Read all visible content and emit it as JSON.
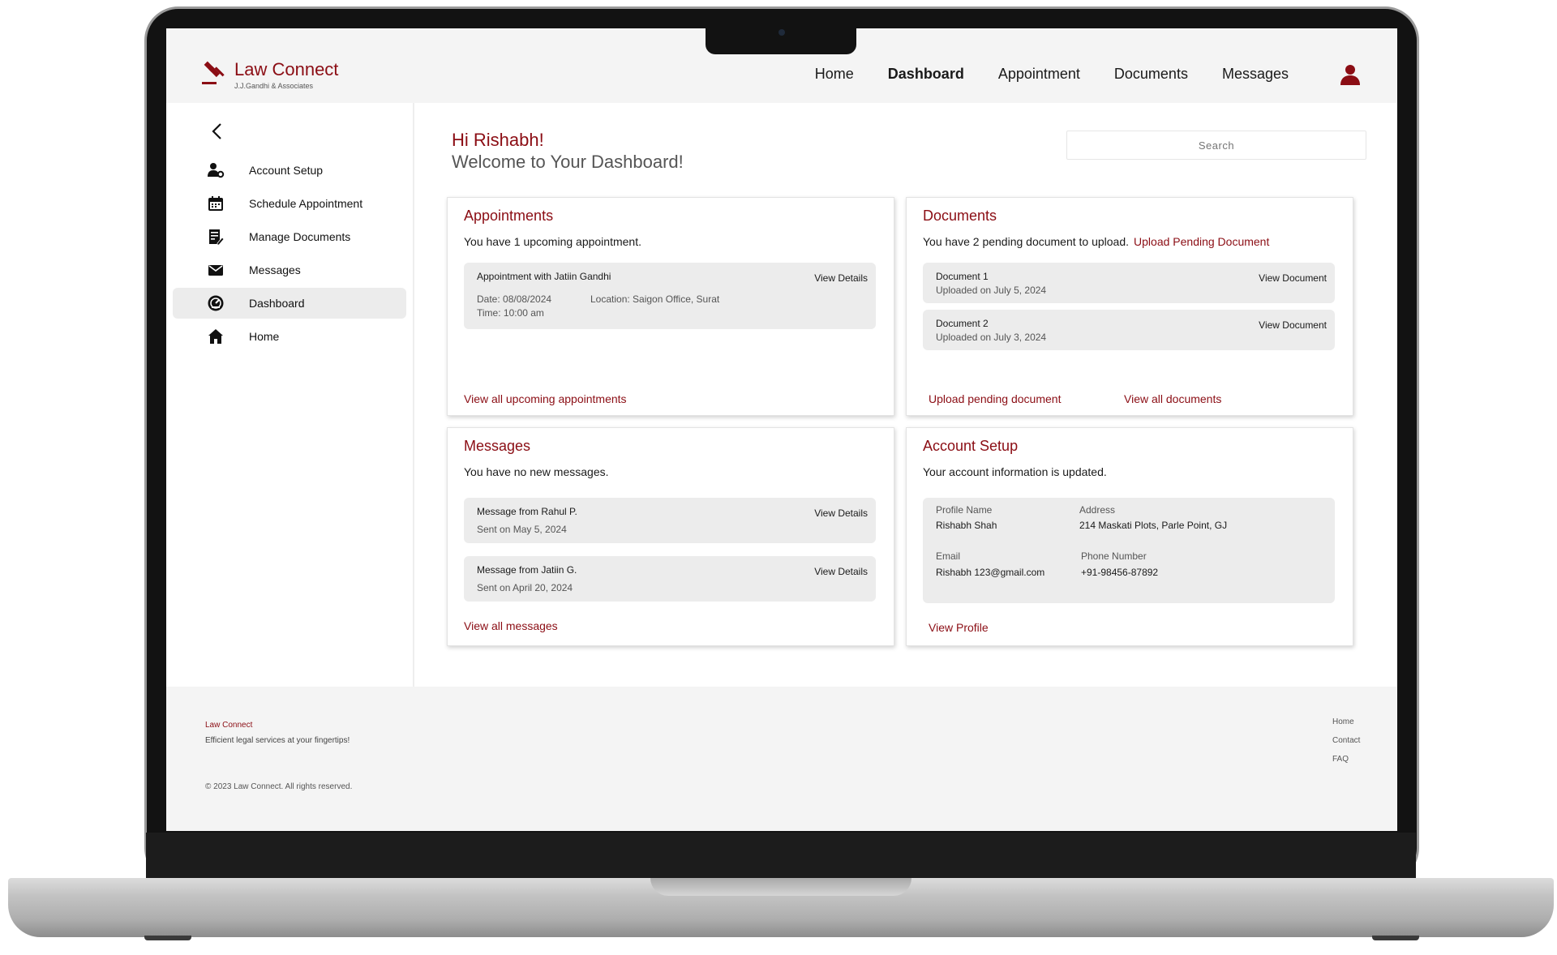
{
  "brand": {
    "name": "Law Connect",
    "subtitle": "J.J.Gandhi & Associates"
  },
  "nav": {
    "items": [
      "Home",
      "Dashboard",
      "Appointment",
      "Documents",
      "Messages"
    ],
    "active": "Dashboard"
  },
  "sidebar": {
    "items": [
      {
        "label": "Account Setup",
        "icon": "user-gear-icon"
      },
      {
        "label": "Schedule Appointment",
        "icon": "calendar-icon"
      },
      {
        "label": "Manage Documents",
        "icon": "document-edit-icon"
      },
      {
        "label": "Messages",
        "icon": "envelope-icon"
      },
      {
        "label": "Dashboard",
        "icon": "dashboard-gauge-icon"
      },
      {
        "label": "Home",
        "icon": "home-icon"
      }
    ],
    "active": "Dashboard"
  },
  "greeting": {
    "name_line": "Hi Rishabh!",
    "welcome_line": "Welcome to Your Dashboard!"
  },
  "search": {
    "placeholder": "Search"
  },
  "appointments": {
    "title": "Appointments",
    "summary": "You have 1 upcoming appointment.",
    "items": [
      {
        "title": "Appointment with Jatiin Gandhi",
        "date": "Date: 08/08/2024",
        "location": "Location: Saigon Office, Surat",
        "time": "Time: 10:00 am",
        "action": "View Details"
      }
    ],
    "footer_link": "View all upcoming appointments"
  },
  "documents": {
    "title": "Documents",
    "summary": "You have 2 pending document to upload.",
    "summary_link": "Upload Pending Document",
    "items": [
      {
        "title": "Document 1",
        "meta": "Uploaded on July 5, 2024",
        "action": "View Document"
      },
      {
        "title": "Document 2",
        "meta": "Uploaded on July 3, 2024",
        "action": "View Document"
      }
    ],
    "footer_links": [
      "Upload pending document",
      "View all documents"
    ]
  },
  "messages": {
    "title": "Messages",
    "summary": "You have no new messages.",
    "items": [
      {
        "title": "Message from Rahul P.",
        "meta": "Sent on May 5, 2024",
        "action": "View Details"
      },
      {
        "title": "Message from Jatiin G.",
        "meta": "Sent on April 20, 2024",
        "action": "View Details"
      }
    ],
    "footer_link": "View all messages"
  },
  "account": {
    "title": "Account Setup",
    "summary": "Your account information is updated.",
    "profile_name_label": "Profile Name",
    "profile_name": "Rishabh Shah",
    "address_label": "Address",
    "address": "214 Maskati Plots, Parle Point, GJ",
    "email_label": "Email",
    "email": "Rishabh 123@gmail.com",
    "phone_label": "Phone Number",
    "phone": "+91-98456-87892",
    "footer_link": "View Profile"
  },
  "footer": {
    "brand": "Law Connect",
    "tagline": "Efficient legal services at your fingertips!",
    "copyright": "© 2023 Law Connect. All rights reserved.",
    "links": [
      "Home",
      "Contact",
      "FAQ"
    ]
  },
  "colors": {
    "accent": "#8b0d14",
    "panel": "#ececec",
    "header": "#f4f4f4"
  }
}
